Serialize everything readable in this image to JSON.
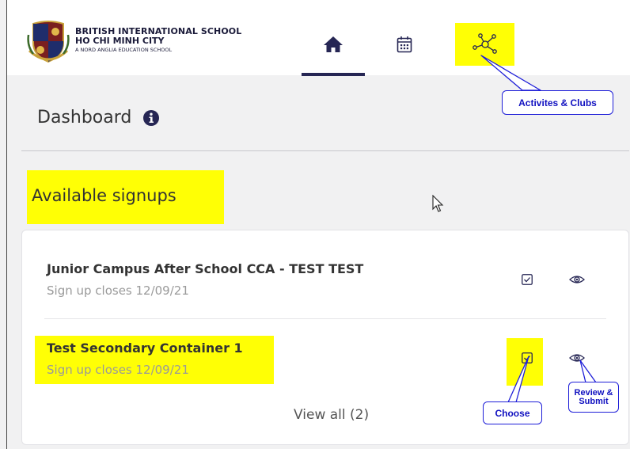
{
  "header": {
    "school_line1": "BRITISH INTERNATIONAL SCHOOL",
    "school_line2": "HO CHI MINH CITY",
    "school_line3": "A NORD ANGLIA EDUCATION SCHOOL",
    "nav": [
      {
        "icon": "home-icon",
        "active": true
      },
      {
        "icon": "calendar-icon",
        "active": false
      },
      {
        "icon": "network-icon",
        "active": false,
        "highlighted": true
      }
    ]
  },
  "dashboard": {
    "title": "Dashboard",
    "info_icon": "info-icon"
  },
  "signups": {
    "title": "Available signups",
    "items": [
      {
        "name": "Junior Campus After School CCA - TEST TEST",
        "closes": "Sign up closes 12/09/21",
        "choose_icon": "checkbox-icon",
        "view_icon": "eye-icon"
      },
      {
        "name": "Test Secondary Container 1",
        "closes": "Sign up closes 12/09/21",
        "choose_icon": "checkbox-icon",
        "view_icon": "eye-icon"
      }
    ],
    "view_all": "View all (2)"
  },
  "annotations": {
    "activities": "Activites & Clubs",
    "choose": "Choose",
    "review_line1": "Review &",
    "review_line2": "Submit"
  },
  "colors": {
    "highlight": "#ffff05",
    "navy": "#262654",
    "callout_blue": "#1e1ed8"
  }
}
